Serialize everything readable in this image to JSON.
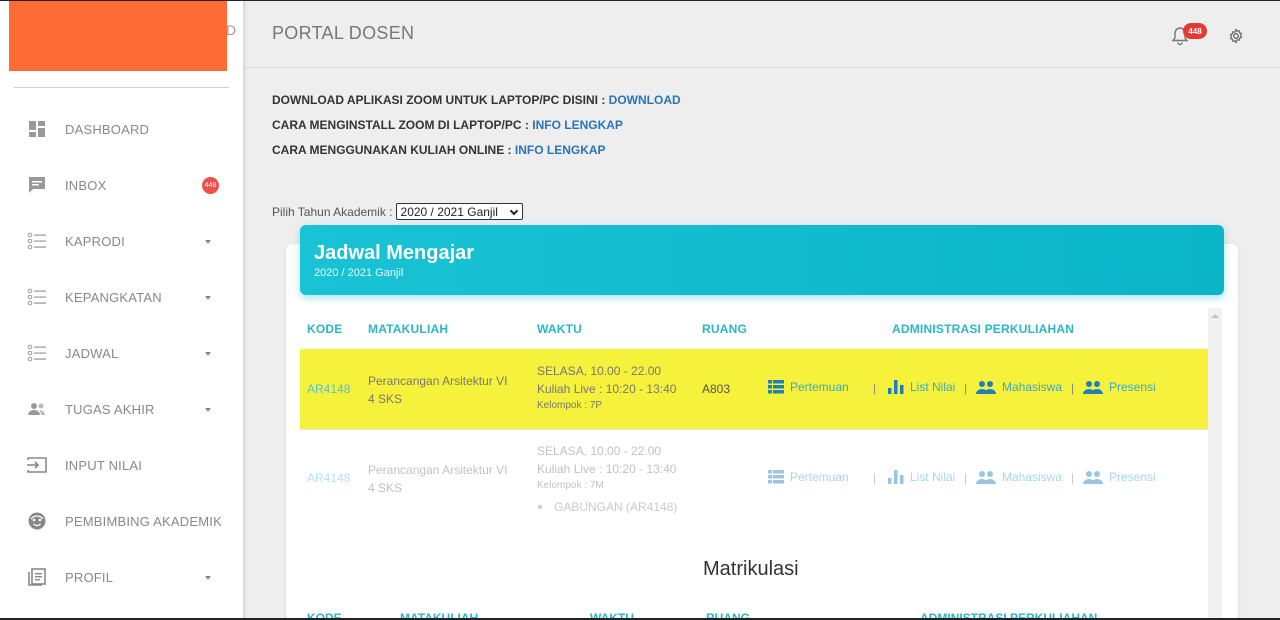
{
  "header": {
    "title": "PORTAL DOSEN",
    "notification_count": "448",
    "brand_peek": "D"
  },
  "sidebar": {
    "items": [
      {
        "label": "DASHBOARD",
        "icon": "dashboard-icon"
      },
      {
        "label": "INBOX",
        "icon": "message-icon",
        "badge": "448"
      },
      {
        "label": "KAPRODI",
        "icon": "list-icon"
      },
      {
        "label": "KEPANGKATAN",
        "icon": "list-icon"
      },
      {
        "label": "JADWAL",
        "icon": "list-icon"
      },
      {
        "label": "TUGAS AKHIR",
        "icon": "group-icon"
      },
      {
        "label": "INPUT NILAI",
        "icon": "input-icon"
      },
      {
        "label": "PEMBIMBING AKADEMIK",
        "icon": "face-icon"
      },
      {
        "label": "PROFIL",
        "icon": "document-icon"
      }
    ]
  },
  "info": [
    {
      "text": "DOWNLOAD APLIKASI ZOOM UNTUK LAPTOP/PC DISINI : ",
      "link": "DOWNLOAD"
    },
    {
      "text": "CARA MENGINSTALL ZOOM DI LAPTOP/PC : ",
      "link": "INFO LENGKAP"
    },
    {
      "text": "CARA MENGGUNAKAN KULIAH ONLINE : ",
      "link": "INFO LENGKAP"
    }
  ],
  "year_filter": {
    "label": "Pilih Tahun Akademik :",
    "selected": "2020 / 2021 Ganjil"
  },
  "schedule": {
    "title": "Jadwal Mengajar",
    "subtitle": "2020 / 2021 Ganjil",
    "columns": [
      "KODE",
      "MATAKULIAH",
      "WAKTU",
      "RUANG",
      "ADMINISTRASI PERKULIAHAN"
    ],
    "rows": [
      {
        "kode": "AR4148",
        "matakuliah": "Perancangan Arsitektur VI",
        "sks": "4 SKS",
        "waktu": "SELASA, 10.00 - 22.00",
        "kuliah_live": "Kuliah Live : 10:20 - 13:40",
        "kelompok": "Kelompok : 7P",
        "ruang": "A803"
      },
      {
        "kode": "AR4148",
        "matakuliah": "Perancangan Arsitektur VI",
        "sks": "4 SKS",
        "waktu": "SELASA, 10.00 - 22.00",
        "kuliah_live": "Kuliah Live : 10:20 - 13:40",
        "kelompok": "Kelompok : 7M",
        "gabungan": "GABUNGAN (AR4148)",
        "ruang": ""
      }
    ],
    "actions": {
      "pertemuan": "Pertemuan",
      "list_nilai": "List Nilai",
      "mahasiswa": "Mahasiswa",
      "presensi": "Presensi",
      "separator": "|"
    }
  },
  "matrikulasi": {
    "title": "Matrikulasi",
    "columns": [
      "KODE",
      "MATAKULIAH",
      "WAKTU",
      "RUANG",
      "ADMINISTRASI PERKULIAHAN"
    ]
  },
  "colors": {
    "accent": "#19c2d4",
    "brand": "#ff6b35",
    "highlight": "#f6f13b",
    "badge": "#f0504d"
  }
}
